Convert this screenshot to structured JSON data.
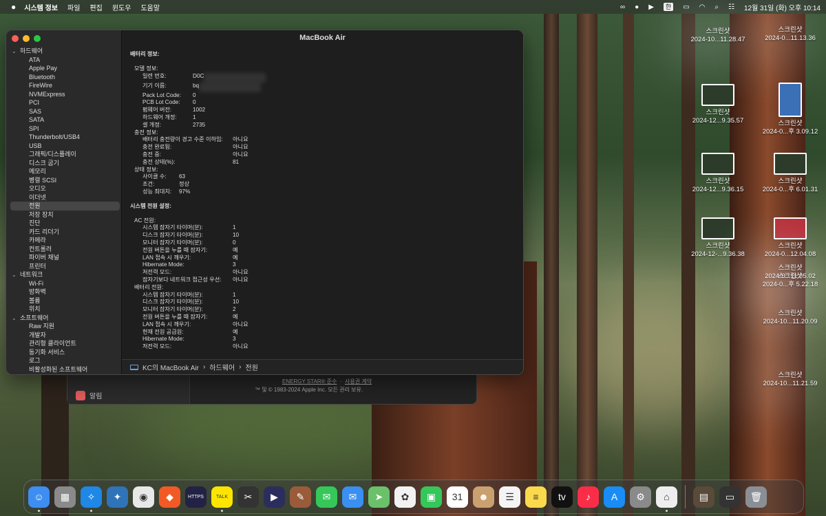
{
  "menubar": {
    "app_name": "시스템 정보",
    "menus": [
      "파일",
      "편집",
      "윈도우",
      "도움말"
    ],
    "ime": "한",
    "clock": "12월 31일 (화) 오후 10:14"
  },
  "window": {
    "title": "MacBook Air",
    "sidebar": [
      {
        "label": "하드웨어",
        "group": true
      },
      {
        "label": "ATA"
      },
      {
        "label": "Apple Pay"
      },
      {
        "label": "Bluetooth"
      },
      {
        "label": "FireWire"
      },
      {
        "label": "NVMExpress"
      },
      {
        "label": "PCI"
      },
      {
        "label": "SAS"
      },
      {
        "label": "SATA"
      },
      {
        "label": "SPI"
      },
      {
        "label": "Thunderbolt/USB4"
      },
      {
        "label": "USB"
      },
      {
        "label": "그래픽/디스플레이"
      },
      {
        "label": "디스크 굽기"
      },
      {
        "label": "메모리"
      },
      {
        "label": "병렬 SCSI"
      },
      {
        "label": "오디오"
      },
      {
        "label": "이더넷"
      },
      {
        "label": "전원",
        "selected": true
      },
      {
        "label": "저장 장치"
      },
      {
        "label": "진단"
      },
      {
        "label": "카드 리더기"
      },
      {
        "label": "카메라"
      },
      {
        "label": "컨트롤러"
      },
      {
        "label": "파이버 채널"
      },
      {
        "label": "프린터"
      },
      {
        "label": "네트워크",
        "group": true
      },
      {
        "label": "Wi-Fi"
      },
      {
        "label": "방화벽"
      },
      {
        "label": "볼륨"
      },
      {
        "label": "위치"
      },
      {
        "label": "소프트웨어",
        "group": true
      },
      {
        "label": "Raw 지원"
      },
      {
        "label": "개발자"
      },
      {
        "label": "관리형 클라이언트"
      },
      {
        "label": "동기화 서비스"
      },
      {
        "label": "로그"
      },
      {
        "label": "비활성화된 소프트웨어"
      }
    ],
    "battery_heading": "배터리 정보:",
    "model_heading": "모델 정보:",
    "model_rows": [
      {
        "k": "일련 번호:",
        "v": "D0C"
      },
      {
        "k": "기기 이름:",
        "v": "bq"
      },
      {
        "k": "Pack Lot Code:",
        "v": "0"
      },
      {
        "k": "PCB Lot Code:",
        "v": "0"
      },
      {
        "k": "펌웨어 버전:",
        "v": "1002"
      },
      {
        "k": "하드웨어 개정:",
        "v": "1"
      },
      {
        "k": "셀 개정:",
        "v": "2735"
      }
    ],
    "charge_heading": "충전 정보:",
    "charge_rows": [
      {
        "k": "배터리 충전량이 경고 수준 이하임:",
        "v": "아니요"
      },
      {
        "k": "충전 완료됨:",
        "v": "아니요"
      },
      {
        "k": "충전 중:",
        "v": "아니요"
      },
      {
        "k": "충전 상태(%):",
        "v": "81"
      }
    ],
    "health_heading": "상태 정보:",
    "health_rows": [
      {
        "k": "사이클 수:",
        "v": "63"
      },
      {
        "k": "조건:",
        "v": "정상"
      },
      {
        "k": "성능 최대치:",
        "v": "97%"
      }
    ],
    "power_heading": "시스템 전원 설정:",
    "ac_heading": "AC 전원:",
    "ac_rows": [
      {
        "k": "시스템 잠자기 타이머(분):",
        "v": "1"
      },
      {
        "k": "디스크 잠자기 타이머(분):",
        "v": "10"
      },
      {
        "k": "모니터 잠자기 타이머(분):",
        "v": "0"
      },
      {
        "k": "전원 버튼을 누를 때 잠자기:",
        "v": "예"
      },
      {
        "k": "LAN 접속 시 깨우기:",
        "v": "예"
      },
      {
        "k": "Hibernate Mode:",
        "v": "3"
      },
      {
        "k": "저전력 모드:",
        "v": "아니요"
      },
      {
        "k": "잠자기보다 네트워크 접근성 우선:",
        "v": "아니요"
      }
    ],
    "battery_power_heading": "배터리 전원:",
    "battery_power_rows": [
      {
        "k": "시스템 잠자기 타이머(분):",
        "v": "1"
      },
      {
        "k": "디스크 잠자기 타이머(분):",
        "v": "10"
      },
      {
        "k": "모니터 잠자기 타이머(분):",
        "v": "2"
      },
      {
        "k": "전원 버튼을 누를 때 잠자기:",
        "v": "예"
      },
      {
        "k": "LAN 접속 시 깨우기:",
        "v": "아니요"
      },
      {
        "k": "현재 전원 공급원:",
        "v": "예"
      },
      {
        "k": "Hibernate Mode:",
        "v": "3"
      },
      {
        "k": "저전력 모드:",
        "v": "아니요"
      }
    ],
    "path": [
      "KC의 MacBook Air",
      "하드웨어",
      "전원"
    ]
  },
  "about": {
    "notification": "알림",
    "energy_star": "ENERGY STAR® 준수",
    "license": "사용권 계약",
    "copyright": "™ 및 © 1983-2024 Apple Inc. 모든 권리 보유."
  },
  "desktop": [
    {
      "name": "스크린샷",
      "date": "2024-10...11.28.47",
      "style": "light"
    },
    {
      "name": "스크린샷",
      "date": "2024-0...11.13.36",
      "style": "light"
    },
    {
      "name": "스크린샷",
      "date": "2024-12...9.35.57",
      "style": "dark"
    },
    {
      "name": "스크린샷",
      "date": "2024-0...후 3.09.12",
      "style": "blue"
    },
    {
      "name": "스크린샷",
      "date": "2024-12...9.36.15",
      "style": "dark"
    },
    {
      "name": "스크린샷",
      "date": "2024-0...후 6.01.31",
      "style": "dark"
    },
    {
      "name": "스크린샷",
      "date": "2024-12-...9.36.38",
      "style": "dark"
    },
    {
      "name": "스크린샷",
      "date": "2024-0...12.04.08",
      "style": "red"
    },
    {
      "name": "스크린샷",
      "date": "2024-0...11.05.02",
      "style": "light"
    },
    {
      "name": "스크린샷",
      "date": "2024-0...후 5.22.18",
      "style": "light"
    },
    {
      "name": "스크린샷",
      "date": "2024-10...11.20.09",
      "style": "light"
    },
    {
      "name": "스크린샷",
      "date": "2024-10...11.21.59",
      "style": "light"
    }
  ],
  "dock": [
    {
      "name": "finder",
      "color": "#3d8ef0",
      "glyph": "☺",
      "running": true
    },
    {
      "name": "launchpad",
      "color": "#8a8a8a",
      "glyph": "▦"
    },
    {
      "name": "safari",
      "color": "#1f87e5",
      "glyph": "✧",
      "running": true
    },
    {
      "name": "twitter",
      "color": "#2f73b8",
      "glyph": "✦"
    },
    {
      "name": "chrome",
      "color": "#e8e8e8",
      "glyph": "◉"
    },
    {
      "name": "brave",
      "color": "#f15a24",
      "glyph": "◆"
    },
    {
      "name": "https-app",
      "color": "#222244",
      "glyph": "HTTPS"
    },
    {
      "name": "kakaotalk",
      "color": "#fde500",
      "glyph": "TALK",
      "running": true
    },
    {
      "name": "final-cut",
      "color": "#333",
      "glyph": "✂"
    },
    {
      "name": "video-app",
      "color": "#2b2e5c",
      "glyph": "▶"
    },
    {
      "name": "script-app",
      "color": "#9a5b3a",
      "glyph": "✎"
    },
    {
      "name": "messages",
      "color": "#35c759",
      "glyph": "✉"
    },
    {
      "name": "mail",
      "color": "#3a8ff0",
      "glyph": "✉"
    },
    {
      "name": "maps",
      "color": "#6bc16a",
      "glyph": "➤"
    },
    {
      "name": "photos",
      "color": "#f2f2f2",
      "glyph": "✿"
    },
    {
      "name": "facetime",
      "color": "#35c759",
      "glyph": "▣"
    },
    {
      "name": "calendar",
      "color": "#ffffff",
      "glyph": "31",
      "sub": "12월"
    },
    {
      "name": "contacts",
      "color": "#c9a070",
      "glyph": "☻"
    },
    {
      "name": "reminders",
      "color": "#f4f4f4",
      "glyph": "☰"
    },
    {
      "name": "notes",
      "color": "#fbd94c",
      "glyph": "≡"
    },
    {
      "name": "apple-tv",
      "color": "#111",
      "glyph": "tv"
    },
    {
      "name": "music",
      "color": "#fa2d48",
      "glyph": "♪"
    },
    {
      "name": "app-store",
      "color": "#1a8cf5",
      "glyph": "A"
    },
    {
      "name": "system-settings",
      "color": "#8a8a8a",
      "glyph": "⚙"
    },
    {
      "name": "system-information",
      "color": "#eeeeee",
      "glyph": "⌂",
      "running": true
    },
    {
      "name": "separator"
    },
    {
      "name": "downloads-stack",
      "color": "#5a4a3a",
      "glyph": "▤"
    },
    {
      "name": "screen-thumbnail",
      "color": "#333",
      "glyph": "▭"
    },
    {
      "name": "trash",
      "color": "#8a8f95",
      "glyph": "🗑"
    }
  ]
}
